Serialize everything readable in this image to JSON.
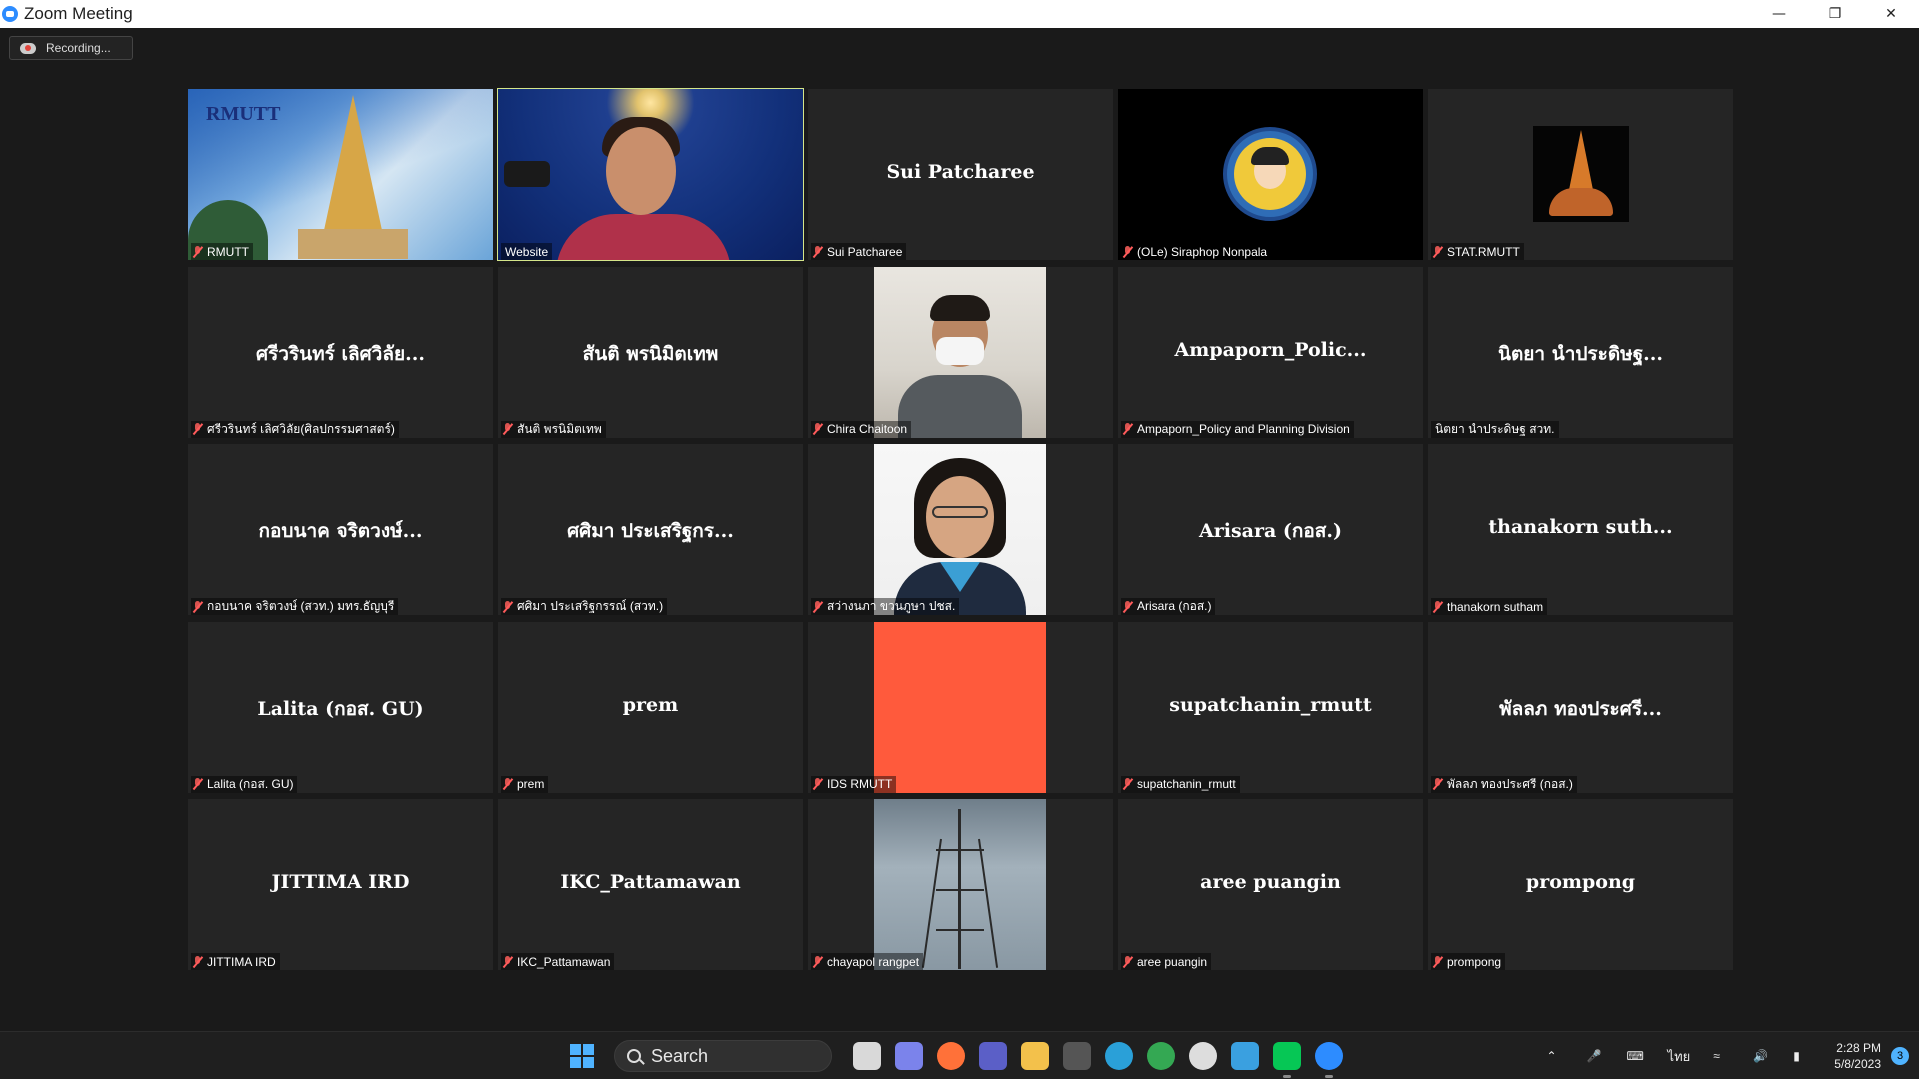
{
  "window": {
    "title": "Zoom Meeting"
  },
  "recording": {
    "label": "Recording..."
  },
  "tiles": [
    {
      "display_name": "",
      "label": "RMUTT",
      "has_mic_icon": true,
      "visual": "rmutt-logo"
    },
    {
      "display_name": "",
      "label": "Website",
      "has_mic_icon": false,
      "visual": "webcam",
      "active_speaker": true
    },
    {
      "display_name": "Sui Patcharee",
      "label": "Sui Patcharee",
      "has_mic_icon": true,
      "visual": "none"
    },
    {
      "display_name": "",
      "label": "(OLe) Siraphop Nonpala",
      "has_mic_icon": true,
      "visual": "avatar"
    },
    {
      "display_name": "",
      "label": "STAT.RMUTT",
      "has_mic_icon": true,
      "visual": "stat-logo"
    },
    {
      "display_name": "ศรีวรินทร์ เลิศวิลัย...",
      "label": "ศรีวรินทร์ เลิศวิลัย(ศิลปกรรมศาสตร์)",
      "has_mic_icon": true,
      "visual": "none"
    },
    {
      "display_name": "สันติ พรนิมิตเทพ",
      "label": "สันติ พรนิมิตเทพ",
      "has_mic_icon": true,
      "visual": "none"
    },
    {
      "display_name": "",
      "label": "Chira Chaitoon",
      "has_mic_icon": true,
      "visual": "photo-tent"
    },
    {
      "display_name": "Ampaporn_Polic...",
      "label": "Ampaporn_Policy and Planning Division",
      "has_mic_icon": true,
      "visual": "none"
    },
    {
      "display_name": "นิตยา นำประดิษฐ...",
      "label": "นิตยา นำประดิษฐ สวท.",
      "has_mic_icon": false,
      "visual": "none"
    },
    {
      "display_name": "กอบนาค จริตวงษ์...",
      "label": "กอบนาค จริตวงษ์ (สวท.) มทร.ธัญบุรี",
      "has_mic_icon": true,
      "visual": "none"
    },
    {
      "display_name": "ศศิมา ประเสริฐกร...",
      "label": "ศศิมา ประเสริฐกรรณ์ (สวท.)",
      "has_mic_icon": true,
      "visual": "none"
    },
    {
      "display_name": "",
      "label": "สว่างนภา ขวนภูษา ปชส.",
      "has_mic_icon": true,
      "visual": "photo-portrait"
    },
    {
      "display_name": "Arisara (กอส.)",
      "label": "Arisara (กอส.)",
      "has_mic_icon": true,
      "visual": "none"
    },
    {
      "display_name": "thanakorn  suth...",
      "label": "thanakorn  sutham",
      "has_mic_icon": true,
      "visual": "none"
    },
    {
      "display_name": "Lalita (กอส. GU)",
      "label": "Lalita (กอส. GU)",
      "has_mic_icon": true,
      "visual": "none"
    },
    {
      "display_name": "prem",
      "label": "prem",
      "has_mic_icon": true,
      "visual": "none"
    },
    {
      "display_name": "",
      "label": "IDS RMUTT",
      "has_mic_icon": true,
      "visual": "solid-red"
    },
    {
      "display_name": "supatchanin_rmutt",
      "label": "supatchanin_rmutt",
      "has_mic_icon": true,
      "visual": "none"
    },
    {
      "display_name": "พัลลภ ทองประศรี...",
      "label": "พัลลภ ทองประศรี (กอส.)",
      "has_mic_icon": true,
      "visual": "none"
    },
    {
      "display_name": "JITTIMA IRD",
      "label": "JITTIMA IRD",
      "has_mic_icon": true,
      "visual": "none"
    },
    {
      "display_name": "IKC_Pattamawan",
      "label": "IKC_Pattamawan",
      "has_mic_icon": true,
      "visual": "none"
    },
    {
      "display_name": "",
      "label": "chayapol rangpet",
      "has_mic_icon": true,
      "visual": "tower"
    },
    {
      "display_name": "aree puangin",
      "label": "aree puangin",
      "has_mic_icon": true,
      "visual": "none"
    },
    {
      "display_name": "prompong",
      "label": "prompong",
      "has_mic_icon": true,
      "visual": "none"
    }
  ],
  "rmutt_logo_text": "RMUTT",
  "taskbar": {
    "search_label": "Search",
    "language": "ไทย",
    "time": "2:28 PM",
    "date": "5/8/2023",
    "notification_count": "3",
    "apps": [
      {
        "icon": "task-view-icon",
        "color": "#d9d9d9"
      },
      {
        "icon": "chat-icon",
        "color": "#7b83eb"
      },
      {
        "icon": "firefox-icon",
        "color": "#ff7139"
      },
      {
        "icon": "teams-icon",
        "color": "#5b5fc7"
      },
      {
        "icon": "file-explorer-icon",
        "color": "#f3c14b"
      },
      {
        "icon": "pen-icon",
        "color": "#555555"
      },
      {
        "icon": "edge-icon",
        "color": "#2aa0d8"
      },
      {
        "icon": "chrome-icon",
        "color": "#34a853"
      },
      {
        "icon": "circle-app-icon",
        "color": "#dddddd"
      },
      {
        "icon": "notepad-icon",
        "color": "#3aa0e0"
      },
      {
        "icon": "line-icon",
        "color": "#06c755"
      },
      {
        "icon": "zoom-icon",
        "color": "#2d8cff"
      }
    ]
  }
}
